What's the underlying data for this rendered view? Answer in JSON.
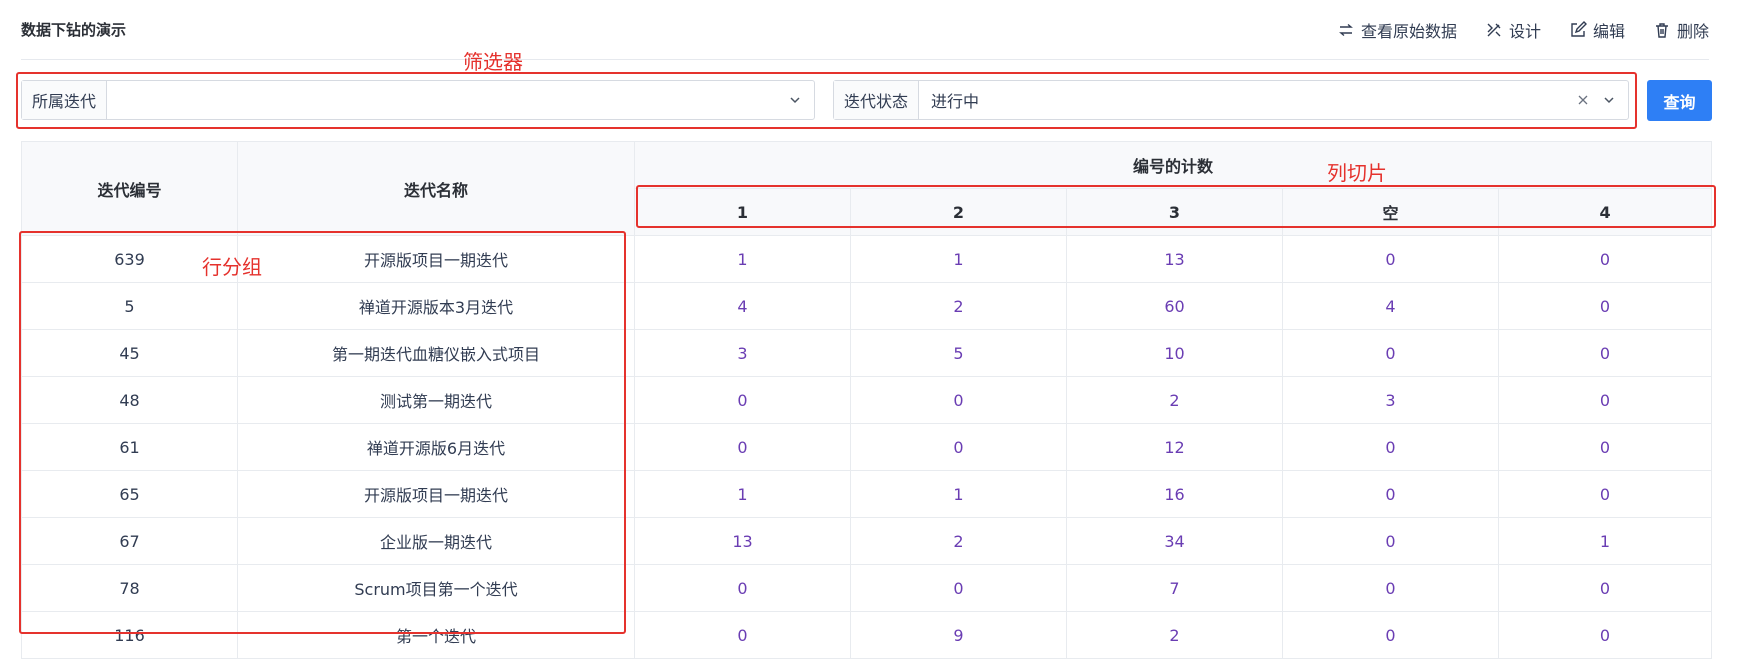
{
  "page_title": "数据下钻的演示",
  "actions": [
    {
      "label": "查看原始数据",
      "icon": "swap-arrows-icon"
    },
    {
      "label": "设计",
      "icon": "design-tools-icon"
    },
    {
      "label": "编辑",
      "icon": "edit-icon"
    },
    {
      "label": "删除",
      "icon": "trash-icon"
    }
  ],
  "filters": {
    "iteration": {
      "label": "所属迭代",
      "value": ""
    },
    "status": {
      "label": "迭代状态",
      "value": "进行中"
    },
    "query_label": "查询"
  },
  "table": {
    "col_id": "迭代编号",
    "col_name": "迭代名称",
    "group_header": "编号的计数",
    "slices": [
      "1",
      "2",
      "3",
      "空",
      "4"
    ],
    "rows": [
      {
        "id": "639",
        "name": "开源版项目一期迭代",
        "counts": [
          "1",
          "1",
          "13",
          "0",
          "0"
        ]
      },
      {
        "id": "5",
        "name": "禅道开源版本3月迭代",
        "counts": [
          "4",
          "2",
          "60",
          "4",
          "0"
        ]
      },
      {
        "id": "45",
        "name": "第一期迭代血糖仪嵌入式项目",
        "counts": [
          "3",
          "5",
          "10",
          "0",
          "0"
        ]
      },
      {
        "id": "48",
        "name": "测试第一期迭代",
        "counts": [
          "0",
          "0",
          "2",
          "3",
          "0"
        ]
      },
      {
        "id": "61",
        "name": "禅道开源版6月迭代",
        "counts": [
          "0",
          "0",
          "12",
          "0",
          "0"
        ]
      },
      {
        "id": "65",
        "name": "开源版项目一期迭代",
        "counts": [
          "1",
          "1",
          "16",
          "0",
          "0"
        ]
      },
      {
        "id": "67",
        "name": "企业版一期迭代",
        "counts": [
          "13",
          "2",
          "34",
          "0",
          "1"
        ]
      },
      {
        "id": "78",
        "name": "Scrum项目第一个迭代",
        "counts": [
          "0",
          "0",
          "7",
          "0",
          "0"
        ]
      },
      {
        "id": "116",
        "name": "第一个迭代",
        "counts": [
          "0",
          "9",
          "2",
          "0",
          "0"
        ]
      }
    ]
  },
  "annotations": {
    "filter": "筛选器",
    "column_slice": "列切片",
    "row_group": "行分组"
  },
  "colors": {
    "accent": "#2e7ff5",
    "annotation": "#e5322d",
    "count_text": "#6a3db3"
  }
}
